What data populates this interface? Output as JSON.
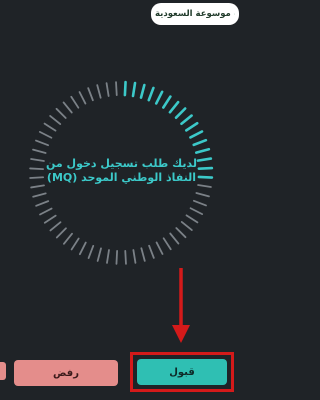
{
  "watermark": {
    "text": "موسوعة السعودية",
    "logo_icon": "palm-swords-logo"
  },
  "spinner": {
    "segments_total": 60,
    "active_segments": 16,
    "active_color": "#3cc9c9",
    "inactive_color": "#7b8187"
  },
  "prompt": {
    "line1": "لديك طلب تسجيل دخول من",
    "line2": "النفاذ الوطني الموحد (MQ)",
    "line3": ""
  },
  "buttons": {
    "reject_label": "رفض",
    "accept_label": "قبول"
  },
  "colors": {
    "background": "#1f2327",
    "accent": "#3cc9c9",
    "highlight": "#d41a1a",
    "reject": "#e48d8b",
    "accept": "#2fbfb3"
  }
}
